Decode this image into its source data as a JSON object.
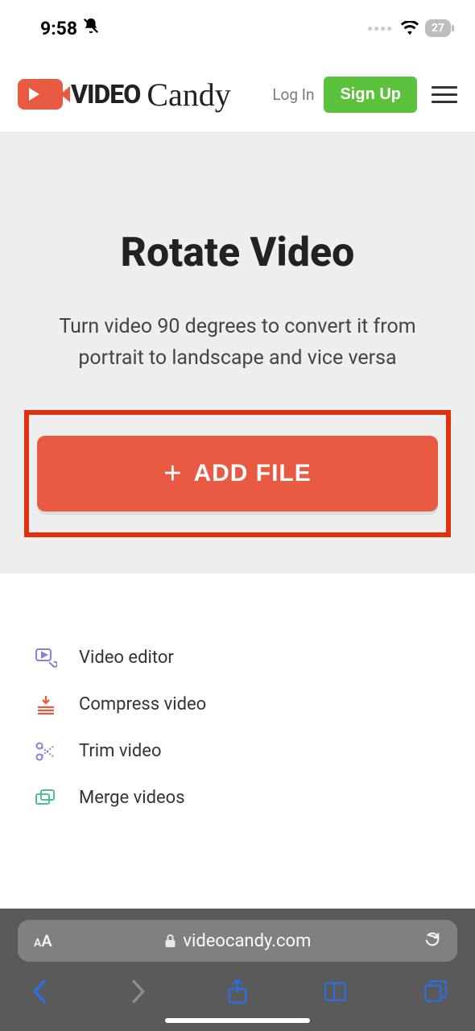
{
  "status": {
    "time": "9:58",
    "battery": "27"
  },
  "header": {
    "logo_text": "VIDEO",
    "logo_script": "Candy",
    "login": "Log In",
    "signup": "Sign Up"
  },
  "hero": {
    "title": "Rotate Video",
    "subtitle": "Turn video 90 degrees to convert it from portrait to landscape and vice versa",
    "add_file": "ADD FILE"
  },
  "tools": [
    {
      "label": "Video editor",
      "icon": "video-editor-icon",
      "color": "#8a7fd6"
    },
    {
      "label": "Compress video",
      "icon": "compress-icon",
      "color": "#e85a42"
    },
    {
      "label": "Trim video",
      "icon": "scissors-icon",
      "color": "#8a7fd6"
    },
    {
      "label": "Merge videos",
      "icon": "merge-icon",
      "color": "#4cc090"
    }
  ],
  "browser": {
    "aa": "AA",
    "url": "videocandy.com"
  }
}
